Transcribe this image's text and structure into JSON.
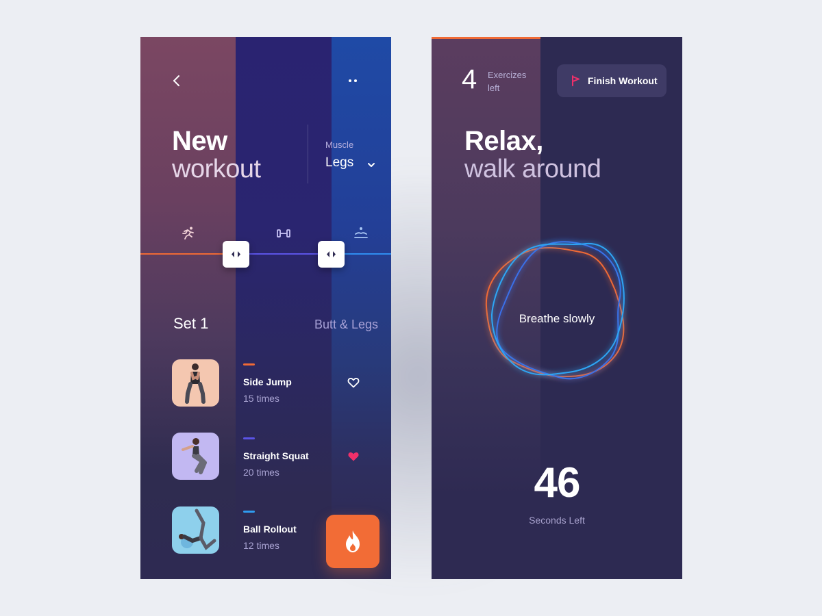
{
  "workout": {
    "title_bold": "New",
    "title_light": "workout",
    "muscle_label": "Muscle",
    "muscle_value": "Legs",
    "types": [
      "running-icon",
      "dumbbell-icon",
      "stretching-icon"
    ],
    "track_colors": [
      "#f06a35",
      "#5b54e6",
      "#2f8df0"
    ],
    "set": {
      "title": "Set 1",
      "subtitle": "Butt & Legs",
      "exercises": [
        {
          "name": "Side Jump",
          "reps": "15 times",
          "accent": "#f06a35",
          "favorite": false,
          "thumb_bg": "#f4c7b0"
        },
        {
          "name": "Straight Squat",
          "reps": "20 times",
          "accent": "#5b54e6",
          "favorite": true,
          "thumb_bg": "#c2b8f2"
        },
        {
          "name": "Ball Rollout",
          "reps": "12 times",
          "accent": "#2f9cf0",
          "favorite": false,
          "thumb_bg": "#8ed0ec"
        }
      ]
    },
    "fire_button_icon": "flame-icon"
  },
  "relax": {
    "count": "4",
    "count_label": "Exercizes left",
    "finish_label": "Finish Workout",
    "title_bold": "Relax,",
    "title_light": "walk around",
    "breathe_text": "Breathe slowly",
    "seconds": "46",
    "seconds_label": "Seconds Left"
  },
  "colors": {
    "accent_orange": "#f26c36",
    "accent_purple": "#5b54e6",
    "accent_blue": "#2f8df0",
    "heart_active": "#f0306a",
    "flag": "#f0306a"
  }
}
